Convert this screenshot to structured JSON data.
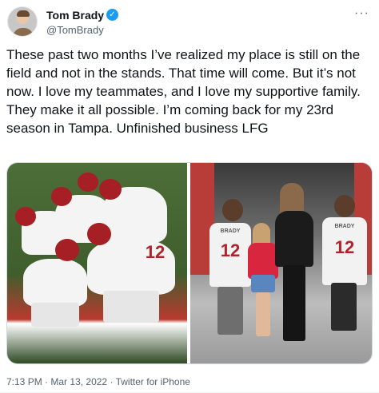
{
  "author": {
    "name": "Tom Brady",
    "handle": "@TomBrady",
    "verified": true,
    "avatar_icon": "profile-photo"
  },
  "more_icon": "more-dots-icon",
  "tweet_text": "These past two months I’ve realized my place is still on the field and not in the stands. That time will come. But it’s not now. I love my teammates, and I love my supportive family. They make it all possible. I’m coming back for my 23rd season in Tampa. Unfinished business LFG",
  "media": {
    "photo1": {
      "jersey_number": "12"
    },
    "photo2": {
      "kid_left_name": "BRADY",
      "kid_left_number": "12",
      "kid_right_name": "BRADY",
      "kid_right_number": "12"
    }
  },
  "meta": {
    "time": "7:13 PM",
    "separator1": "·",
    "date": "Mar 13, 2022",
    "separator2": "·",
    "source": "Twitter for iPhone"
  },
  "colors": {
    "verified_blue": "#1d9bf0",
    "secondary_text": "#536471",
    "buccaneers_red": "#a51f24"
  }
}
